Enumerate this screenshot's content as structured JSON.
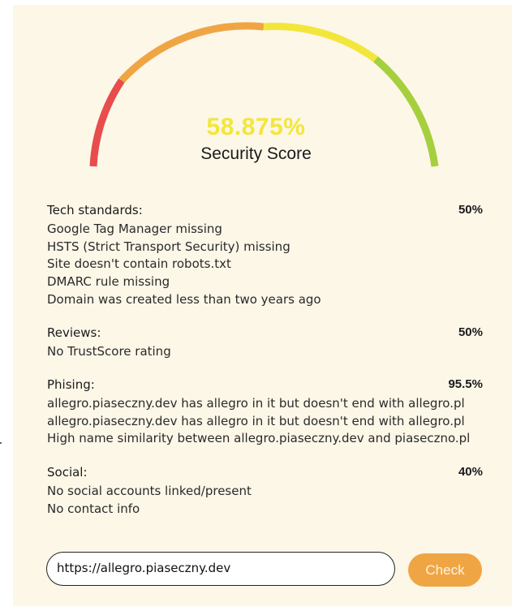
{
  "score": {
    "value": "58.875%",
    "label": "Security Score",
    "value_fraction": 0.58875,
    "value_color": "#f3e63a"
  },
  "gauge_colors": {
    "red": "#e84c4c",
    "orange": "#f0a544",
    "yellow": "#f3e63a",
    "green": "#a6cf3e"
  },
  "sections": [
    {
      "title": "Tech standards:",
      "percent": "50%",
      "items": [
        "Google Tag Manager missing",
        "HSTS (Strict Transport Security) missing",
        "Site doesn't contain robots.txt",
        "DMARC rule missing",
        "Domain was created less than two years ago"
      ]
    },
    {
      "title": "Reviews:",
      "percent": "50%",
      "items": [
        "No TrustScore rating"
      ]
    },
    {
      "title": "Phising:",
      "percent": "95.5%",
      "items": [
        "allegro.piaseczny.dev has allegro in it but doesn't end with allegro.pl",
        "allegro.piaseczny.dev has allegro in it but doesn't end with allegro.pl",
        "High name similarity between allegro.piaseczny.dev and piaseczno.pl"
      ]
    },
    {
      "title": "Social:",
      "percent": "40%",
      "items": [
        "No social accounts linked/present",
        "No contact info"
      ]
    }
  ],
  "url_input": {
    "value": "https://allegro.piaseczny.dev"
  },
  "check_button": {
    "label": "Check",
    "color": "#f0a544"
  }
}
